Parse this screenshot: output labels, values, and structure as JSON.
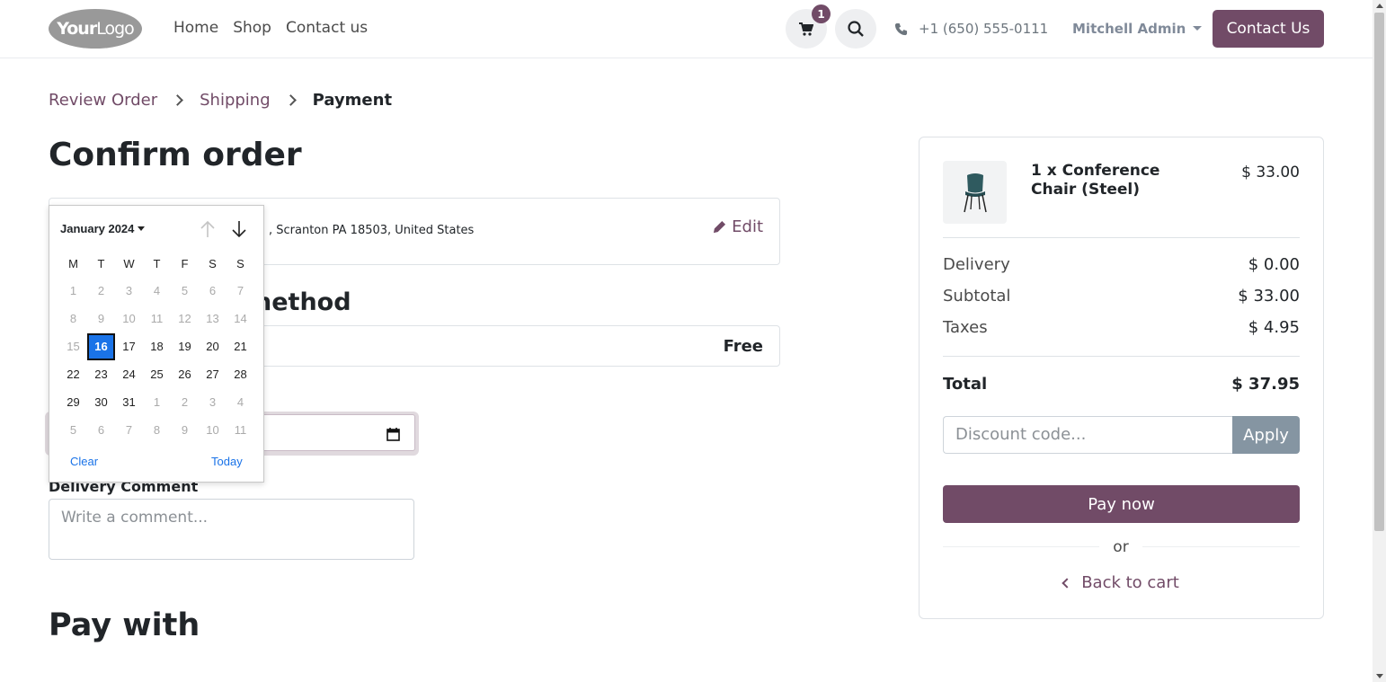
{
  "header": {
    "logo_text_bold": "Your",
    "logo_text_thin": "Logo",
    "nav": [
      "Home",
      "Shop",
      "Contact us"
    ],
    "cart_count": "1",
    "phone": "+1 (650) 555-0111",
    "user": "Mitchell Admin",
    "contact_button": "Contact Us"
  },
  "breadcrumb": {
    "items": [
      "Review Order",
      "Shipping",
      "Payment"
    ]
  },
  "page_title": "Confirm order",
  "address": {
    "text": ", Scranton PA 18503, United States",
    "edit_label": "Edit"
  },
  "delivery": {
    "title_partial": "nethod",
    "price": "Free"
  },
  "comment": {
    "label": "Delivery Comment",
    "placeholder": "Write a comment..."
  },
  "pay_with_title": "Pay with",
  "calendar": {
    "month_label": "January 2024",
    "weekdays": [
      "M",
      "T",
      "W",
      "T",
      "F",
      "S",
      "S"
    ],
    "days": [
      {
        "d": "1",
        "m": true
      },
      {
        "d": "2",
        "m": true
      },
      {
        "d": "3",
        "m": true
      },
      {
        "d": "4",
        "m": true
      },
      {
        "d": "5",
        "m": true
      },
      {
        "d": "6",
        "m": true
      },
      {
        "d": "7",
        "m": true
      },
      {
        "d": "8",
        "m": true
      },
      {
        "d": "9",
        "m": true
      },
      {
        "d": "10",
        "m": true
      },
      {
        "d": "11",
        "m": true
      },
      {
        "d": "12",
        "m": true
      },
      {
        "d": "13",
        "m": true
      },
      {
        "d": "14",
        "m": true
      },
      {
        "d": "15",
        "m": true
      },
      {
        "d": "16",
        "sel": true
      },
      {
        "d": "17"
      },
      {
        "d": "18"
      },
      {
        "d": "19"
      },
      {
        "d": "20"
      },
      {
        "d": "21"
      },
      {
        "d": "22"
      },
      {
        "d": "23"
      },
      {
        "d": "24"
      },
      {
        "d": "25"
      },
      {
        "d": "26"
      },
      {
        "d": "27"
      },
      {
        "d": "28"
      },
      {
        "d": "29"
      },
      {
        "d": "30"
      },
      {
        "d": "31"
      },
      {
        "d": "1",
        "o": true
      },
      {
        "d": "2",
        "o": true
      },
      {
        "d": "3",
        "o": true
      },
      {
        "d": "4",
        "o": true
      },
      {
        "d": "5",
        "o": true
      },
      {
        "d": "6",
        "o": true
      },
      {
        "d": "7",
        "o": true
      },
      {
        "d": "8",
        "o": true
      },
      {
        "d": "9",
        "o": true
      },
      {
        "d": "10",
        "o": true
      },
      {
        "d": "11",
        "o": true
      }
    ],
    "clear_label": "Clear",
    "today_label": "Today"
  },
  "summary": {
    "product_name": "1 x Conference Chair (Steel)",
    "product_price": "$ 33.00",
    "delivery_label": "Delivery",
    "delivery_value": "$ 0.00",
    "subtotal_label": "Subtotal",
    "subtotal_value": "$ 33.00",
    "taxes_label": "Taxes",
    "taxes_value": "$ 4.95",
    "total_label": "Total",
    "total_value": "$ 37.95",
    "discount_placeholder": "Discount code...",
    "apply_label": "Apply",
    "pay_label": "Pay now",
    "or_label": "or",
    "back_label": "Back to cart"
  },
  "colors": {
    "brand": "#714b67",
    "calendar_selected": "#1a73e8"
  }
}
